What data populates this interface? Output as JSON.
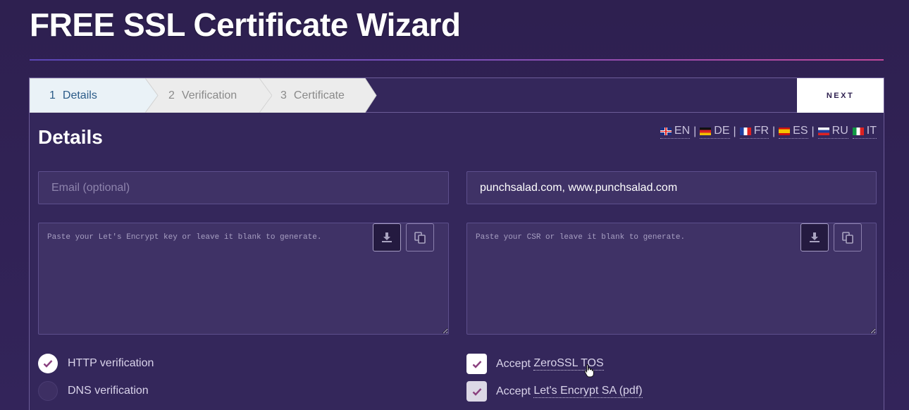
{
  "page": {
    "title": "FREE SSL Certificate Wizard"
  },
  "steps": [
    {
      "number": "1",
      "label": "Details",
      "active": true
    },
    {
      "number": "2",
      "label": "Verification",
      "active": false
    },
    {
      "number": "3",
      "label": "Certificate",
      "active": false
    }
  ],
  "next_label": "NEXT",
  "details": {
    "heading": "Details"
  },
  "languages": [
    {
      "code": "EN",
      "flag": "uk-flag-icon"
    },
    {
      "code": "DE",
      "flag": "germany-flag-icon"
    },
    {
      "code": "FR",
      "flag": "france-flag-icon"
    },
    {
      "code": "ES",
      "flag": "spain-flag-icon"
    },
    {
      "code": "RU",
      "flag": "russia-flag-icon"
    },
    {
      "code": "IT",
      "flag": "italy-flag-icon"
    }
  ],
  "language_separator": "|",
  "form": {
    "email_placeholder": "Email (optional)",
    "email_value": "",
    "domains_value": "punchsalad.com, www.punchsalad.com",
    "key_placeholder": "Paste your Let's Encrypt key or leave it blank to generate.",
    "csr_placeholder": "Paste your CSR or leave it blank to generate."
  },
  "verification": {
    "http_label": "HTTP verification",
    "dns_label": "DNS verification",
    "selected": "http"
  },
  "agreements": {
    "tos_prefix": "Accept ",
    "tos_link": "ZeroSSL TOS",
    "sa_prefix": "Accept ",
    "sa_link": "Let's Encrypt SA (pdf)",
    "tos_checked": true,
    "sa_checked": true
  },
  "colors": {
    "background": "#2f2150",
    "panel": "#34275b",
    "accent_check": "#8a3f7e",
    "active_step_text": "#2b5b88"
  }
}
